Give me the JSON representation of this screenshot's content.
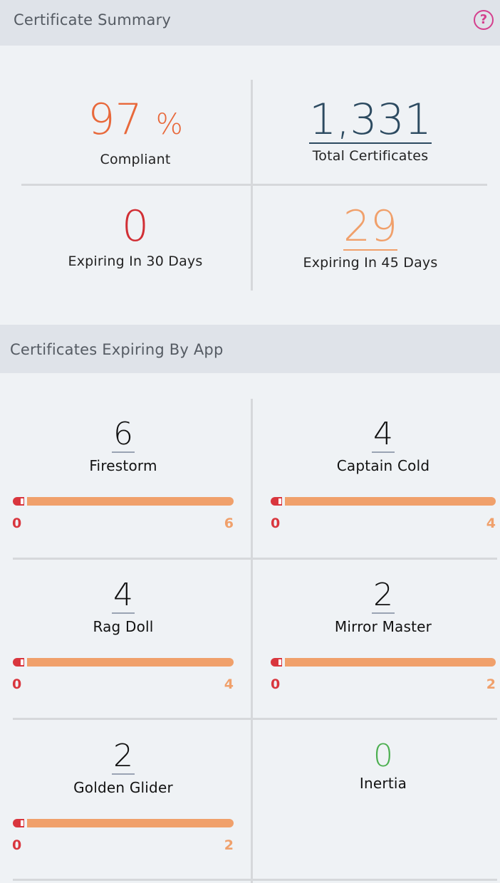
{
  "summary": {
    "title": "Certificate Summary",
    "help_icon": "?",
    "compliant": {
      "value": "97",
      "unit": "%",
      "label": "Compliant"
    },
    "total": {
      "value": "1,331",
      "label": "Total Certificates"
    },
    "expiring30": {
      "value": "0",
      "label": "Expiring In 30 Days"
    },
    "expiring45": {
      "value": "29",
      "label": "Expiring In 45 Days"
    }
  },
  "by_app": {
    "title": "Certificates Expiring By App",
    "apps": [
      {
        "count": "6",
        "name": "Firestorm",
        "min": "0",
        "max": "6"
      },
      {
        "count": "4",
        "name": "Captain Cold",
        "min": "0",
        "max": "4"
      },
      {
        "count": "4",
        "name": "Rag Doll",
        "min": "0",
        "max": "4"
      },
      {
        "count": "2",
        "name": "Mirror Master",
        "min": "0",
        "max": "2"
      },
      {
        "count": "2",
        "name": "Golden Glider",
        "min": "0",
        "max": "2"
      },
      {
        "count": "0",
        "name": "Inertia"
      }
    ]
  },
  "colors": {
    "compliant": "#e8683a",
    "total": "#2c4a60",
    "expiring30": "#d12f35",
    "expiring45": "#f0a06b",
    "zero_count": "#4caf50",
    "help_icon": "#d43f8d"
  }
}
